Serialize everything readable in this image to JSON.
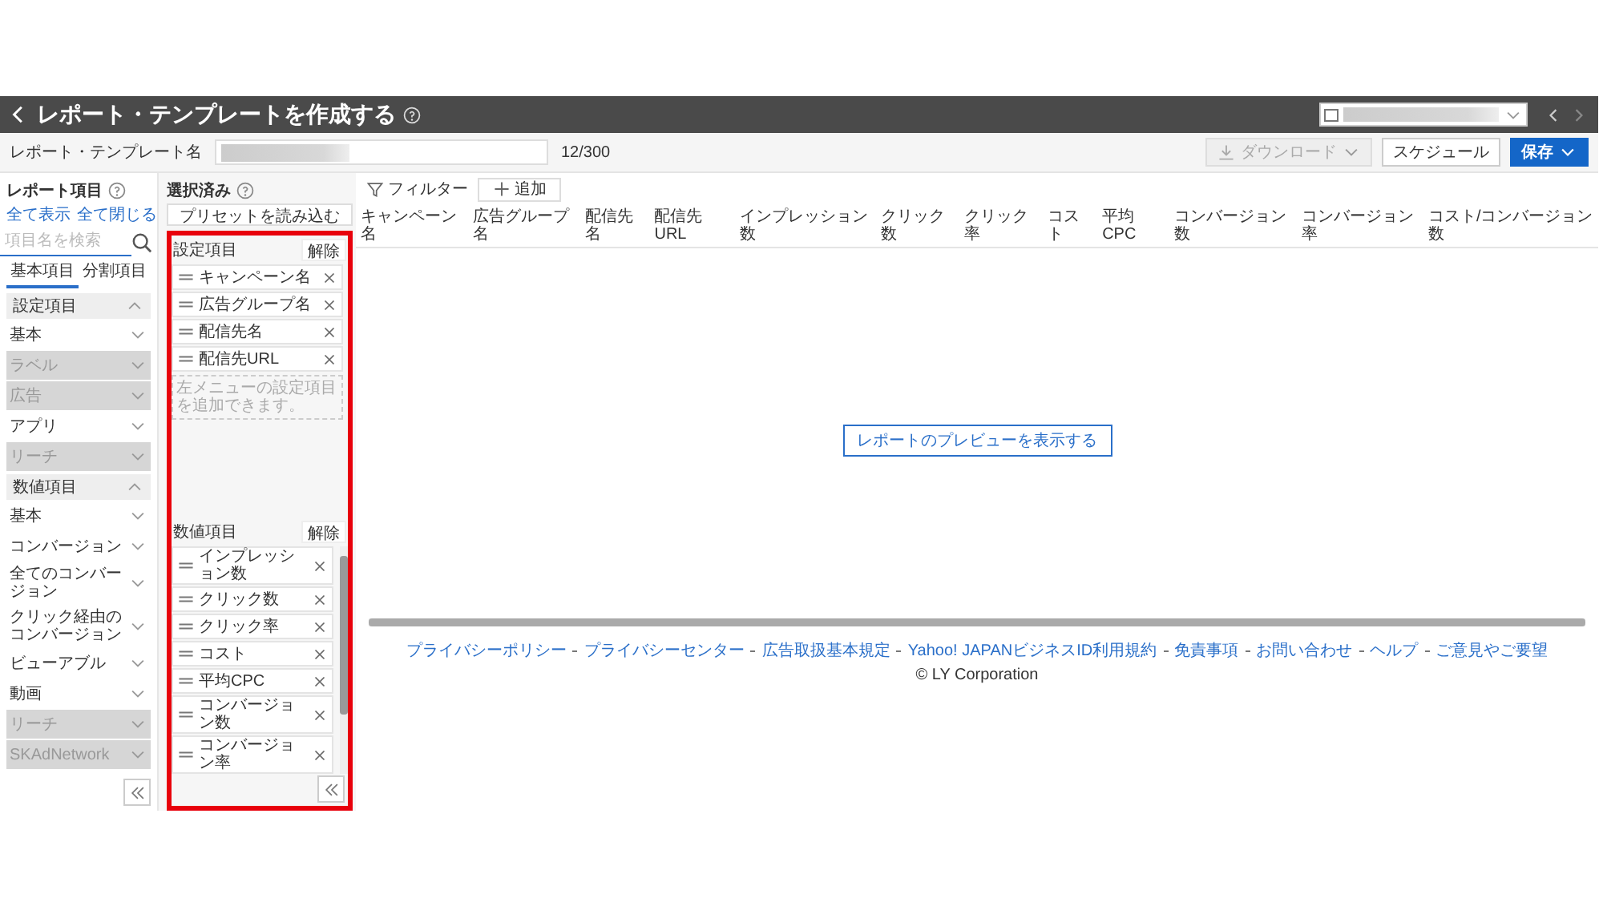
{
  "header": {
    "title": "レポート・テンプレートを作成する"
  },
  "account_select": {
    "value_redacted": true
  },
  "name_row": {
    "label": "レポート・テンプレート名",
    "value_redacted": true,
    "counter": "12/300",
    "buttons": [
      {
        "label": "ダウンロード",
        "kind": "menu",
        "disabled": true
      },
      {
        "label": "スケジュール",
        "kind": "plain",
        "disabled": false
      },
      {
        "label": "保存",
        "kind": "primary",
        "disabled": false
      }
    ]
  },
  "report_items": {
    "title": "レポート項目",
    "links": [
      "全て表示",
      "全て閉じる"
    ],
    "search": {
      "placeholder": "項目名を検索"
    },
    "tabs": [
      {
        "label": "基本項目",
        "selected": true
      },
      {
        "label": "分割項目",
        "selected": false
      }
    ],
    "sections": [
      {
        "title": "設定項目",
        "expanded": true,
        "items": [
          {
            "label": "基本",
            "disabled": false
          },
          {
            "label": "ラベル",
            "disabled": true
          },
          {
            "label": "広告",
            "disabled": true
          },
          {
            "label": "アプリ",
            "disabled": false
          },
          {
            "label": "リーチ",
            "disabled": true
          }
        ]
      },
      {
        "title": "数値項目",
        "expanded": true,
        "items": [
          {
            "label": "基本",
            "disabled": false
          },
          {
            "label": "コンバージョン",
            "disabled": false
          },
          {
            "label": "全てのコンバージョン",
            "disabled": false
          },
          {
            "label": "クリック経由のコンバージョン",
            "disabled": false
          },
          {
            "label": "ビューアブル",
            "disabled": false
          },
          {
            "label": "動画",
            "disabled": false
          },
          {
            "label": "リーチ",
            "disabled": true
          },
          {
            "label": "SKAdNetwork",
            "disabled": true
          }
        ]
      }
    ]
  },
  "selected": {
    "title": "選択済み",
    "preset_button": "プリセットを読み込む",
    "highlighted": true,
    "groups": [
      {
        "title": "設定項目",
        "clear": "解除",
        "items": [
          "キャンペーン名",
          "広告グループ名",
          "配信先名",
          "配信先URL"
        ],
        "hint": "左メニューの設定項目を追加できます。"
      },
      {
        "title": "数値項目",
        "clear": "解除",
        "items": [
          "インプレッション数",
          "クリック数",
          "クリック率",
          "コスト",
          "平均CPC",
          "コンバージョン数",
          "コンバージョン率"
        ]
      }
    ]
  },
  "toolbar": {
    "filter": "フィルター",
    "add": "追加"
  },
  "table": {
    "columns": [
      "キャンペーン名",
      "広告グループ名",
      "配信先名",
      "配信先URL",
      "インプレッション数",
      "クリック数",
      "クリック率",
      "コスト",
      "平均CPC",
      "コンバージョン数",
      "コンバージョン率",
      "コスト/コンバージョン数"
    ]
  },
  "preview_button": "レポートのプレビューを表示する",
  "footer": {
    "links": [
      "プライバシーポリシー",
      "プライバシーセンター",
      "広告取扱基本規定",
      "Yahoo! JAPANビジネスID利用規約",
      "免責事項",
      "お問い合わせ",
      "ヘルプ",
      "ご意見やご要望"
    ],
    "copyright": "© LY Corporation"
  }
}
